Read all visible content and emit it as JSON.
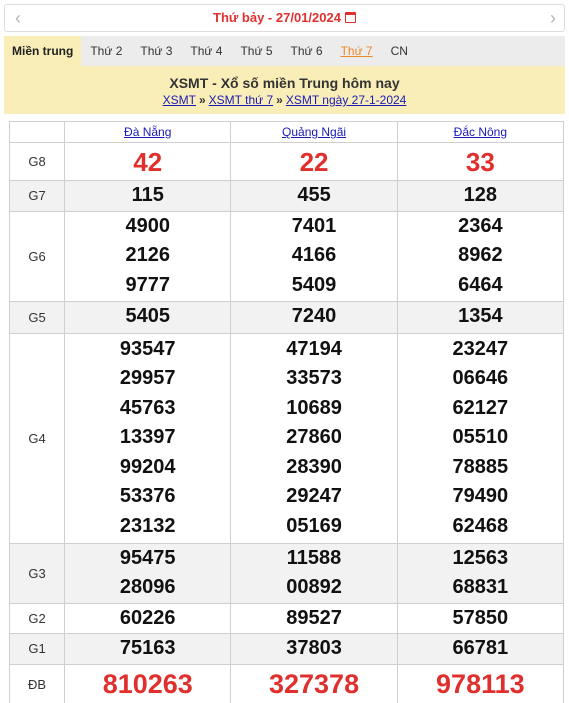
{
  "datebar": {
    "prev_icon": "‹",
    "next_icon": "›",
    "weekday": "Thứ bảy -",
    "date": "27/01/2024"
  },
  "tabs": [
    "Miền trung",
    "Thứ 2",
    "Thứ 3",
    "Thứ 4",
    "Thứ 5",
    "Thứ 6",
    "Thứ 7",
    "CN"
  ],
  "header": {
    "title": "XSMT - Xổ số miền Trung hôm nay",
    "crumb1": "XSMT",
    "sep": "»",
    "crumb2": "XSMT thứ 7",
    "crumb3": "XSMT ngày 27-1-2024"
  },
  "provinces": [
    "Đà Nẵng",
    "Quảng Ngãi",
    "Đắc Nông"
  ],
  "prizes": [
    {
      "label": "G8",
      "values": [
        [
          "42"
        ],
        [
          "22"
        ],
        [
          "33"
        ]
      ]
    },
    {
      "label": "G7",
      "values": [
        [
          "115"
        ],
        [
          "455"
        ],
        [
          "128"
        ]
      ]
    },
    {
      "label": "G6",
      "values": [
        [
          "4900",
          "2126",
          "9777"
        ],
        [
          "7401",
          "4166",
          "5409"
        ],
        [
          "2364",
          "8962",
          "6464"
        ]
      ]
    },
    {
      "label": "G5",
      "values": [
        [
          "5405"
        ],
        [
          "7240"
        ],
        [
          "1354"
        ]
      ]
    },
    {
      "label": "G4",
      "values": [
        [
          "93547",
          "29957",
          "45763",
          "13397",
          "99204",
          "53376",
          "23132"
        ],
        [
          "47194",
          "33573",
          "10689",
          "27860",
          "28390",
          "29247",
          "05169"
        ],
        [
          "23247",
          "06646",
          "62127",
          "05510",
          "78885",
          "79490",
          "62468"
        ]
      ]
    },
    {
      "label": "G3",
      "values": [
        [
          "95475",
          "28096"
        ],
        [
          "11588",
          "00892"
        ],
        [
          "12563",
          "68831"
        ]
      ]
    },
    {
      "label": "G2",
      "values": [
        [
          "60226"
        ],
        [
          "89527"
        ],
        [
          "57850"
        ]
      ]
    },
    {
      "label": "G1",
      "values": [
        [
          "75163"
        ],
        [
          "37803"
        ],
        [
          "66781"
        ]
      ]
    },
    {
      "label": "ĐB",
      "values": [
        [
          "810263"
        ],
        [
          "327378"
        ],
        [
          "978113"
        ]
      ]
    }
  ]
}
